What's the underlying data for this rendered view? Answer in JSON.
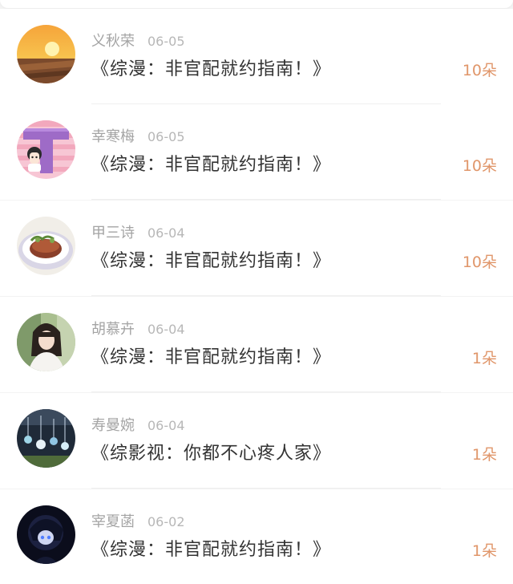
{
  "colors": {
    "count_accent": "#e0966a",
    "title_text": "#333333",
    "meta_text": "#a4a4a4"
  },
  "items": [
    {
      "name": "义秋荣",
      "date": "06-05",
      "title": "《综漫：非官配就约指南！》",
      "count": "10朵",
      "avatar_icon": "sunset-field-avatar-icon"
    },
    {
      "name": "幸寒梅",
      "date": "06-05",
      "title": "《综漫：非官配就约指南！》",
      "count": "10朵",
      "avatar_icon": "letter-t-cartoon-avatar-icon"
    },
    {
      "name": "甲三诗",
      "date": "06-04",
      "title": "《综漫：非官配就约指南！》",
      "count": "10朵",
      "avatar_icon": "food-plate-avatar-icon"
    },
    {
      "name": "胡慕卉",
      "date": "06-04",
      "title": "《综漫：非官配就约指南！》",
      "count": "1朵",
      "avatar_icon": "girl-photo-avatar-icon"
    },
    {
      "name": "寿曼婉",
      "date": "06-04",
      "title": "《综影视：你都不心疼人家》",
      "count": "1朵",
      "avatar_icon": "wind-chimes-avatar-icon"
    },
    {
      "name": "宰夏菡",
      "date": "06-02",
      "title": "《综漫：非官配就约指南！》",
      "count": "1朵",
      "avatar_icon": "dark-anime-avatar-icon"
    }
  ]
}
